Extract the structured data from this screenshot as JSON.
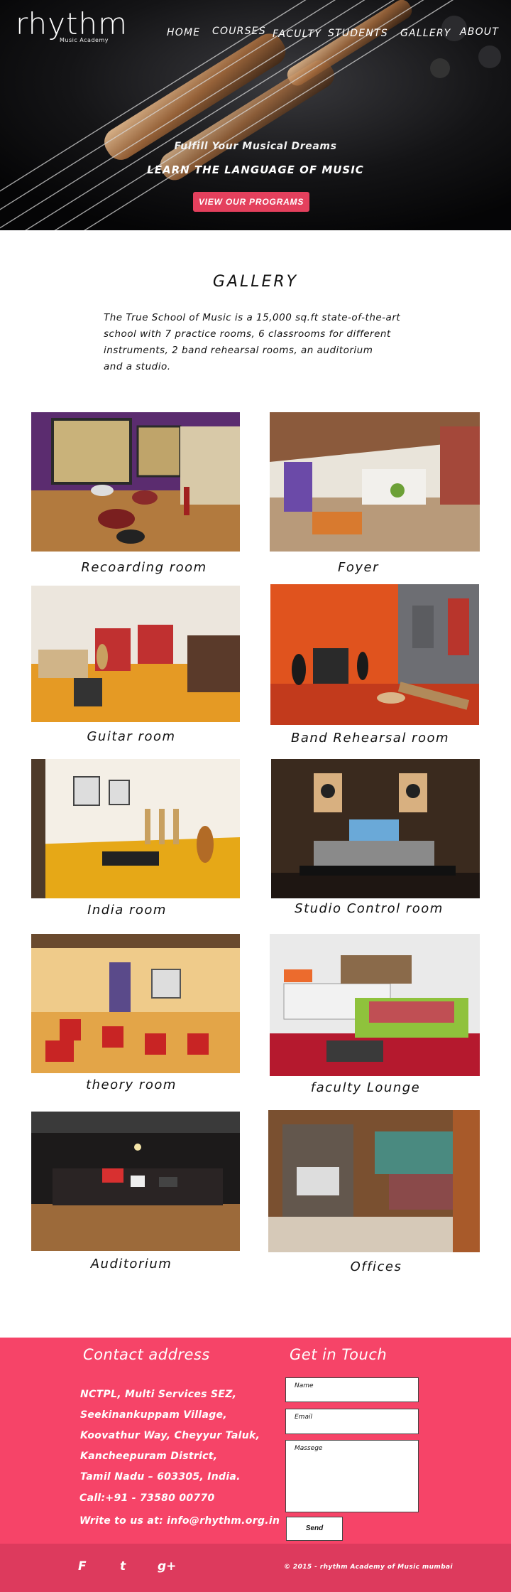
{
  "brand": {
    "name": "rhythm",
    "tagline": "Music Academy"
  },
  "nav": {
    "items": [
      "HOME",
      "COURSES",
      "FACULTY",
      "STUDENTS",
      "GALLERY",
      "ABOUT"
    ]
  },
  "hero": {
    "tagline": "Fulfill Your Musical Dreams",
    "headline": "LEARN THE LANGUAGE OF MUSIC",
    "cta_label": "VIEW OUR PROGRAMS"
  },
  "gallery": {
    "title": "GALLERY",
    "intro": "The True School of Music is a 15,000 sq.ft state-of-the-art\nschool with 7 practice rooms, 6 classrooms for different\ninstruments, 2 band rehearsal rooms, an auditorium\nand a studio.",
    "items": [
      {
        "caption": "Recoarding room"
      },
      {
        "caption": "Foyer"
      },
      {
        "caption": "Guitar room"
      },
      {
        "caption": "Band Rehearsal room"
      },
      {
        "caption": "India room"
      },
      {
        "caption": "Studio Control room"
      },
      {
        "caption": "theory room"
      },
      {
        "caption": "faculty Lounge"
      },
      {
        "caption": "Auditorium"
      },
      {
        "caption": "Offices"
      }
    ]
  },
  "contact": {
    "address_title": "Contact address",
    "address": "NCTPL, Multi Services SEZ,\nSeekinankuppam Village,\nKoovathur Way, Cheyyur Taluk,\nKancheepuram District,\nTamil Nadu – 603305, India.",
    "phone": "Call:+91 - 73580 00770",
    "email_line": "Write to us at: info@rhythm.org.in",
    "form_title": "Get in Touch",
    "name_placeholder": "Name",
    "email_placeholder": "Email",
    "message_placeholder": "Massege",
    "send_label": "Send"
  },
  "footer": {
    "social": [
      "F",
      "t",
      "g+"
    ],
    "copyright": "© 2015 - rhythm Academy of Music mumbai"
  },
  "colors": {
    "accent": "#f64468",
    "footer": "#dd3a5d",
    "cta": "#e4405d"
  }
}
